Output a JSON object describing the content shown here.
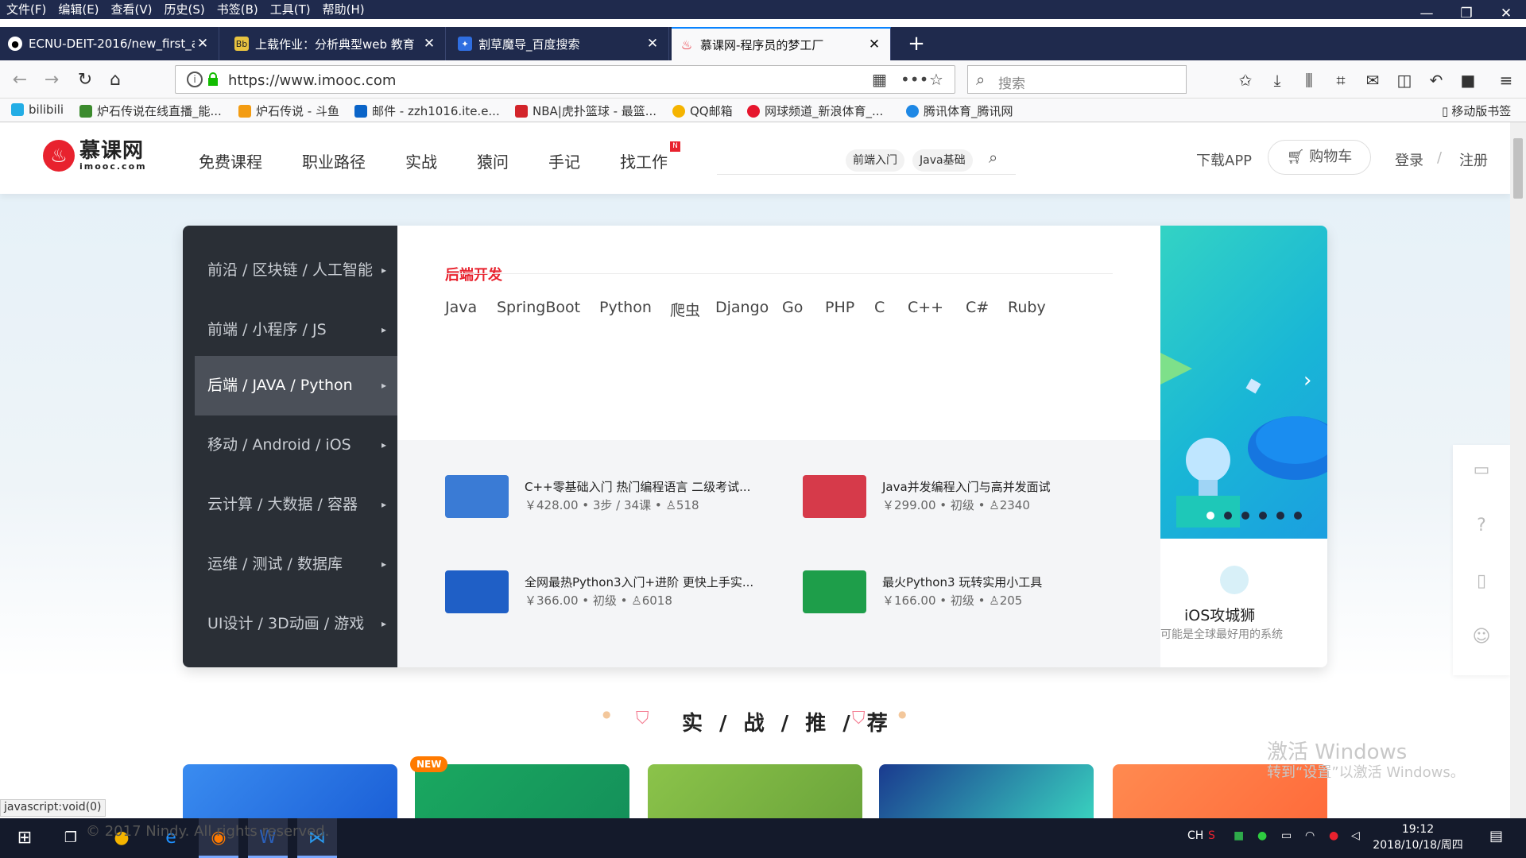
{
  "menubar": {
    "items": [
      "文件(F)",
      "编辑(E)",
      "查看(V)",
      "历史(S)",
      "书签(B)",
      "工具(T)",
      "帮助(H)"
    ]
  },
  "window": {
    "minimize": "—",
    "restore": "❐",
    "close": "✕"
  },
  "tabs": [
    {
      "title": "ECNU-DEIT-2016/new_first_a",
      "icon": "github-icon"
    },
    {
      "title": "上载作业：分析典型web 教育",
      "icon": "blackboard-icon"
    },
    {
      "title": "割草魔导_百度搜索",
      "icon": "baidu-icon"
    },
    {
      "title": "慕课网-程序员的梦工厂",
      "icon": "imooc-icon"
    }
  ],
  "navbar": {
    "url": "https://www.imooc.com",
    "search_placeholder": "搜索"
  },
  "bookmarks": [
    "bilibili",
    "炉石传说在线直播_能...",
    "炉石传说 - 斗鱼",
    "邮件 - zzh1016.ite.e...",
    "NBA|虎扑篮球 - 最篮...",
    "QQ邮箱",
    "网球频道_新浪体育_...",
    "腾讯体育_腾讯网"
  ],
  "mobile_bookmarks": "移动版书签",
  "site": {
    "logo_text": "慕课网",
    "logo_sub": "imooc.com",
    "nav": [
      "免费课程",
      "职业路径",
      "实战",
      "猿问",
      "手记",
      "找工作"
    ],
    "nav_badge": "N",
    "search_tags": [
      "前端入门",
      "Java基础"
    ],
    "download_app": "下载APP",
    "cart": "购物车",
    "login": "登录",
    "slash": "/",
    "register": "注册"
  },
  "sidebar": [
    {
      "label": "前沿 / 区块链 / 人工智能",
      "active": false
    },
    {
      "label": "前端 / 小程序 / JS",
      "active": false
    },
    {
      "label": "后端 / JAVA / Python",
      "active": true
    },
    {
      "label": "移动 / Android / iOS",
      "active": false
    },
    {
      "label": "云计算 / 大数据 / 容器",
      "active": false
    },
    {
      "label": "运维 / 测试 / 数据库",
      "active": false
    },
    {
      "label": "UI设计 / 3D动画 / 游戏",
      "active": false
    }
  ],
  "panel": {
    "title": "后端开发",
    "keywords": [
      "Java",
      "SpringBoot",
      "Python",
      "爬虫",
      "Django",
      "Go",
      "PHP",
      "C",
      "C++",
      "C#",
      "Ruby"
    ],
    "courses": [
      {
        "name": "C++零基础入门 热门编程语言 二级考试...",
        "meta": "￥428.00 • 3步 / 34课 • ♙518",
        "color": "#3a7bd5"
      },
      {
        "name": "Java并发编程入门与高并发面试",
        "meta": "￥299.00 • 初级 • ♙2340",
        "color": "#d63a4a"
      },
      {
        "name": "全网最热Python3入门+进阶 更快上手实...",
        "meta": "￥366.00 • 初级 • ♙6018",
        "color": "#1f5fc6"
      },
      {
        "name": "最火Python3 玩转实用小工具",
        "meta": "￥166.00 • 初级 • ♙205",
        "color": "#1e9e4a"
      }
    ]
  },
  "banner": {
    "title": "iOS攻城狮",
    "desc": "可能是全球最好用的系统",
    "dots": 6,
    "active_dot": 0
  },
  "section": {
    "title": "实 / 战 / 推 / 荐"
  },
  "promo_new": "NEW",
  "watermark": {
    "line1": "激活 Windows",
    "line2": "转到“设置”以激活 Windows。"
  },
  "status_url": "javascript:void(0)",
  "taskbar": {
    "footer_text": "© 2017 Nindy. All rights reserved.",
    "time": "19:12",
    "date": "2018/10/18/周四",
    "ime": "CH"
  }
}
